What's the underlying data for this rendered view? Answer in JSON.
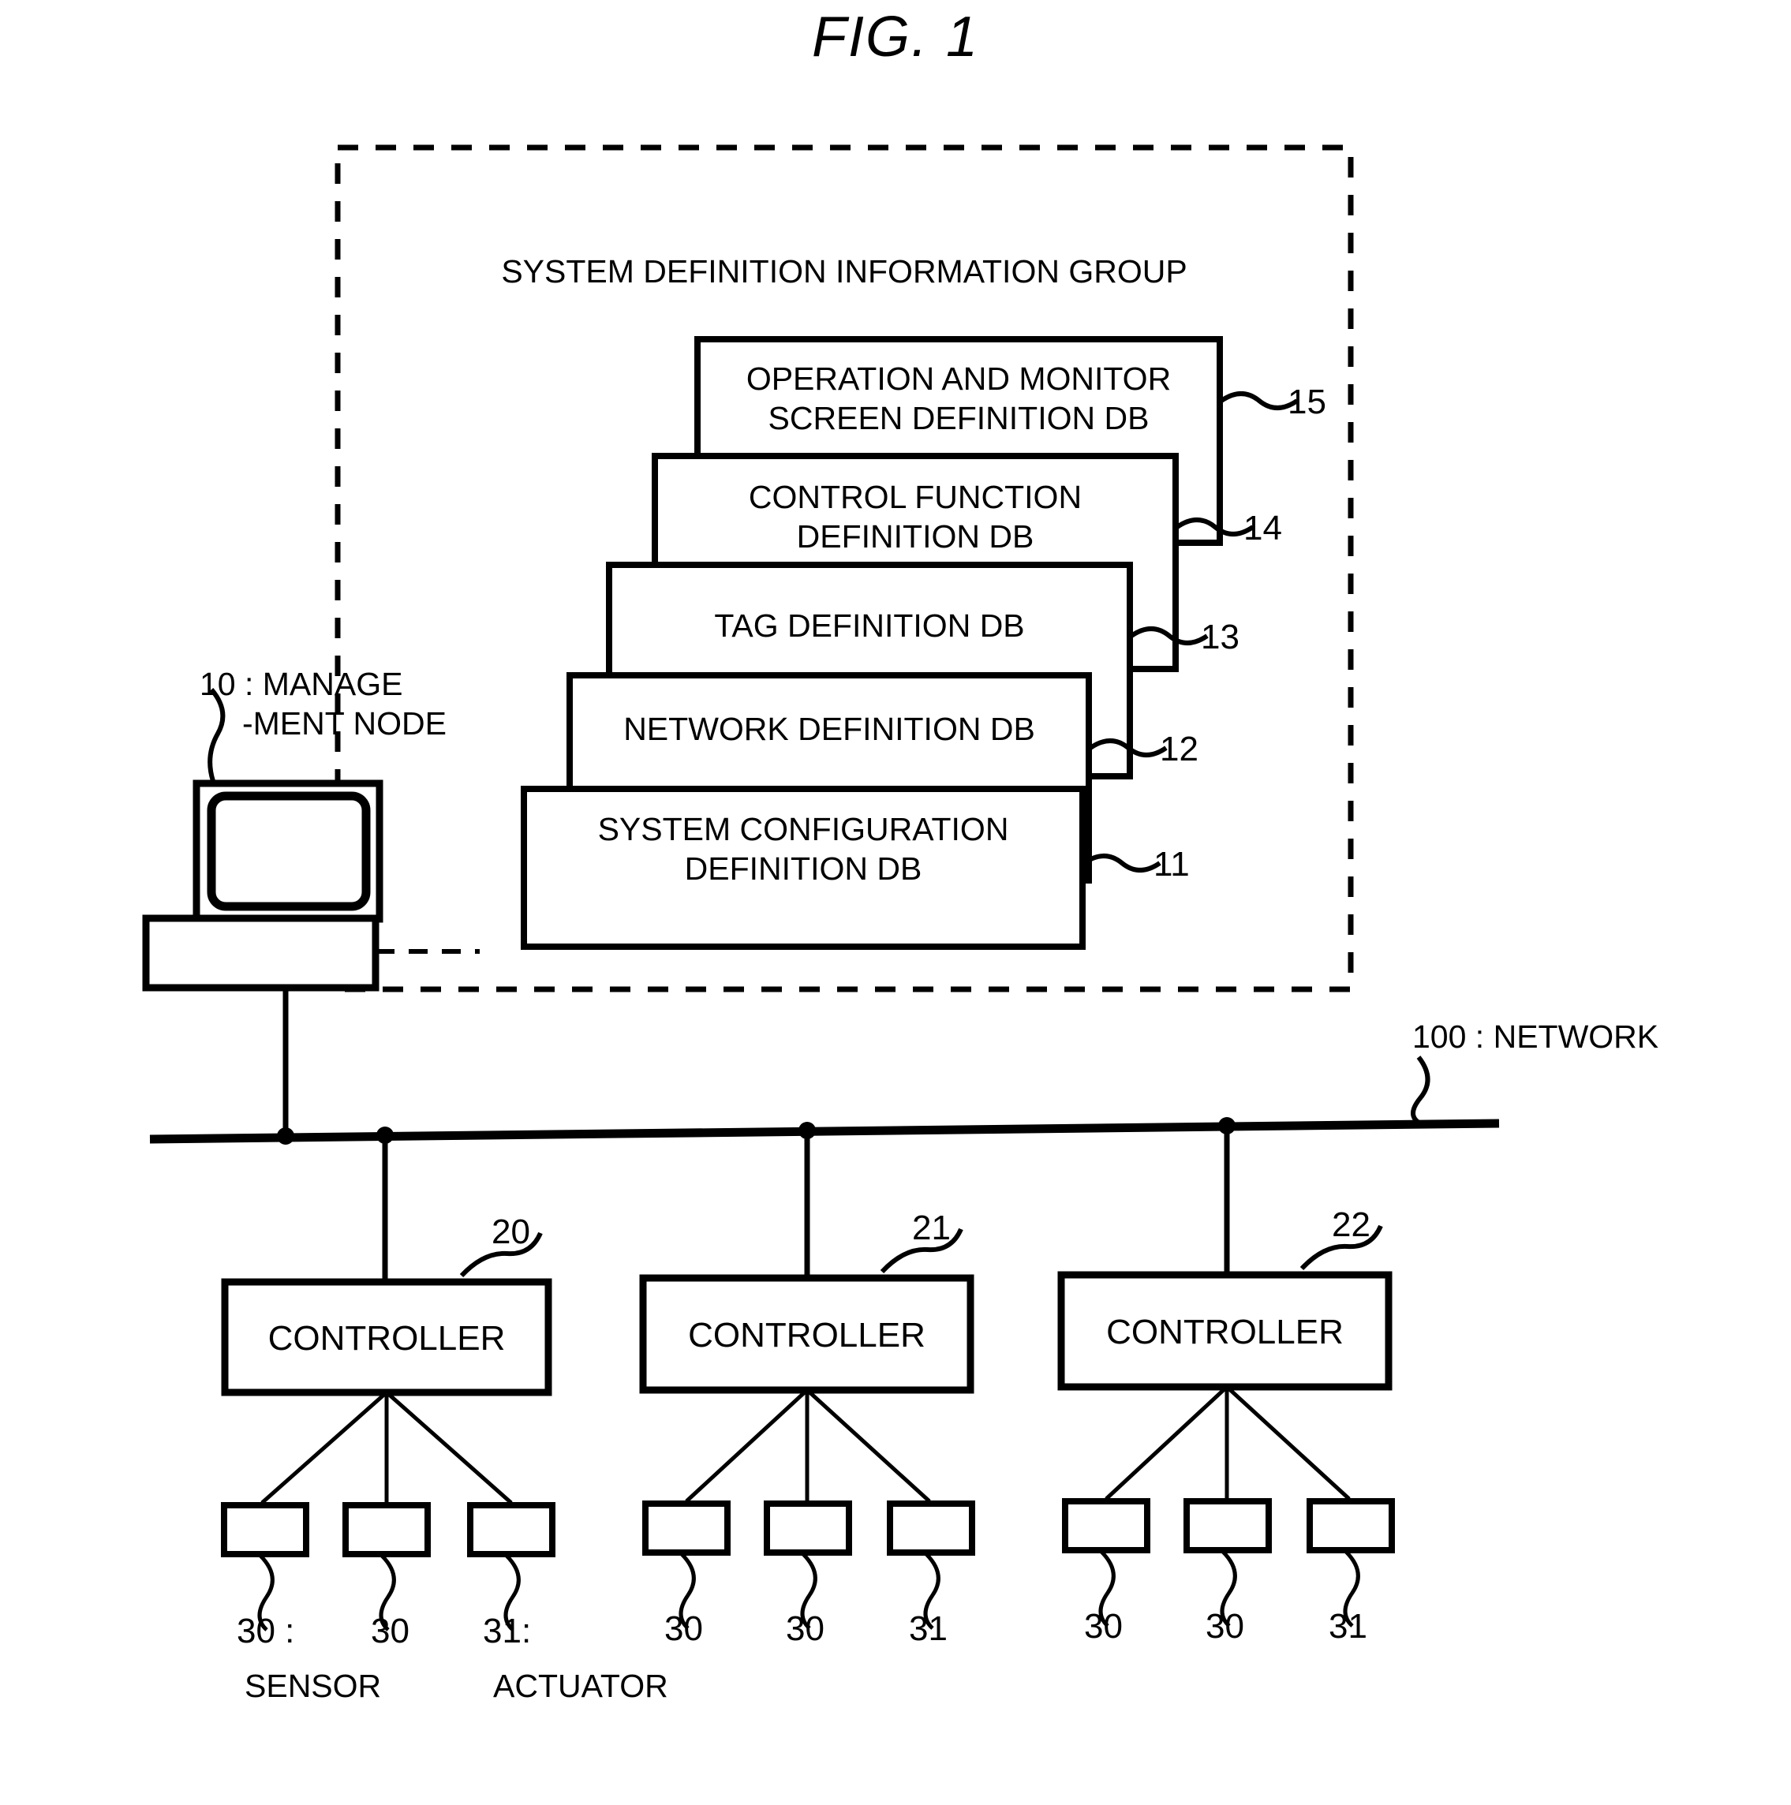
{
  "figure": {
    "title": "FIG. 1"
  },
  "system_definition_group": {
    "title": "SYSTEM DEFINITION INFORMATION GROUP",
    "databases": [
      {
        "ref": "15",
        "line1": "OPERATION AND MONITOR",
        "line2": "SCREEN DEFINITION DB"
      },
      {
        "ref": "14",
        "line1": "CONTROL FUNCTION",
        "line2": "DEFINITION DB"
      },
      {
        "ref": "13",
        "line1": "TAG DEFINITION DB",
        "line2": ""
      },
      {
        "ref": "12",
        "line1": "NETWORK DEFINITION DB",
        "line2": ""
      },
      {
        "ref": "11",
        "line1": "SYSTEM CONFIGURATION",
        "line2": "DEFINITION DB"
      }
    ]
  },
  "management_node": {
    "label_line1": "10 : MANAGE",
    "label_line2": "-MENT NODE"
  },
  "network": {
    "label": "100 : NETWORK"
  },
  "controllers": [
    {
      "ref": "20",
      "label": "CONTROLLER"
    },
    {
      "ref": "21",
      "label": "CONTROLLER"
    },
    {
      "ref": "22",
      "label": "CONTROLLER"
    }
  ],
  "devices": {
    "group1": [
      {
        "ref": "30 :",
        "name": "SENSOR"
      },
      {
        "ref": "30",
        "name": ""
      },
      {
        "ref": "31:",
        "name": "ACTUATOR"
      }
    ],
    "group2": [
      {
        "ref": "30",
        "name": ""
      },
      {
        "ref": "30",
        "name": ""
      },
      {
        "ref": "31",
        "name": ""
      }
    ],
    "group3": [
      {
        "ref": "30",
        "name": ""
      },
      {
        "ref": "30",
        "name": ""
      },
      {
        "ref": "31",
        "name": ""
      }
    ]
  },
  "colors": {
    "ink": "#000000",
    "paper": "#ffffff"
  }
}
